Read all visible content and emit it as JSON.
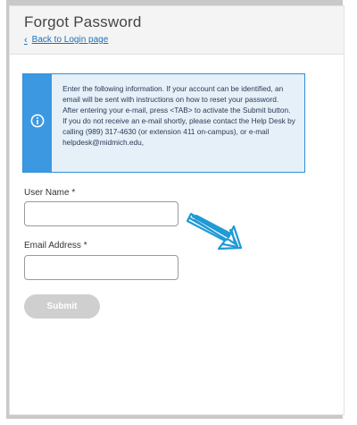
{
  "page": {
    "title": "Forgot Password",
    "back_link": "Back to Login page"
  },
  "info": {
    "icon": "info-icon",
    "message": "Enter the following information. If your account can be identified, an email will be sent with instructions on how to reset your password. After entering your e-mail, press <TAB> to activate the Submit button. If you do not receive an e-mail shortly, please contact the Help Desk by calling (989) 317-4630 (or extension 411 on-campus), or e-mail helpdesk@midmich.edu,"
  },
  "form": {
    "username_label": "User Name *",
    "username_value": "",
    "email_label": "Email Address *",
    "email_value": "",
    "submit_label": "Submit",
    "submit_enabled": false
  },
  "annotation": {
    "icon": "pointer-arrow-icon",
    "color": "#1e9ad6"
  },
  "colors": {
    "link": "#1d6fb8",
    "info_accent": "#3c98e0",
    "info_bg": "#e6f0f9",
    "disabled_button": "#cfcfcf"
  }
}
